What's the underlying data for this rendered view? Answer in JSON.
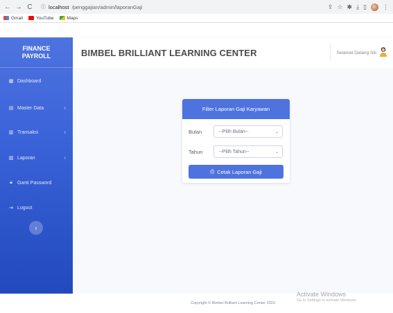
{
  "browser": {
    "back_icon": "←",
    "forward_icon": "→",
    "reload_icon": "C",
    "url_host": "localhost",
    "url_path": "/penggajian/admin/laporanGaji",
    "toolbar_icons": [
      "share-icon",
      "star-icon",
      "extensions-icon",
      "download-icon",
      "window-icon",
      "profile-avatar",
      "more-icon"
    ]
  },
  "bookmarks": [
    {
      "label": "Gmail",
      "icon": "gmail-icon"
    },
    {
      "label": "YouTube",
      "icon": "youtube-icon"
    },
    {
      "label": "Maps",
      "icon": "maps-icon"
    }
  ],
  "sidebar": {
    "brand_line1": "FINANCE",
    "brand_line2": "PAYROLL",
    "items": [
      {
        "label": "Dashboard",
        "icon": "dashboard-icon",
        "has_submenu": false
      },
      {
        "label": "Master Data",
        "icon": "database-icon",
        "has_submenu": true
      },
      {
        "label": "Transaksi",
        "icon": "transaction-icon",
        "has_submenu": true
      },
      {
        "label": "Laporan",
        "icon": "report-icon",
        "has_submenu": true
      },
      {
        "label": "Ganti Password",
        "icon": "lock-icon",
        "has_submenu": false
      },
      {
        "label": "Logout",
        "icon": "logout-icon",
        "has_submenu": false
      }
    ]
  },
  "topbar": {
    "title": "BIMBEL BRILLIANT LEARNING CENTER",
    "greeting": "Selamat Datang Siti"
  },
  "card": {
    "header": "Filter Laporan Gaji Karyawan",
    "month_label": "Bulan",
    "month_value": "--Pilih Bulan--",
    "year_label": "Tahun",
    "year_value": "--Pilih Tahun--",
    "print_button": "Cetak Laporan Gaji"
  },
  "footer": {
    "copyright": "Copyright © Bimbel Brilliant Learning Center 2023"
  },
  "watermark": {
    "title": "Activate Windows",
    "subtitle": "Go to Settings to activate Windows."
  },
  "colors": {
    "primary": "#4e73df",
    "sidebar_dark": "#224abe",
    "background": "#f8f9fc"
  }
}
